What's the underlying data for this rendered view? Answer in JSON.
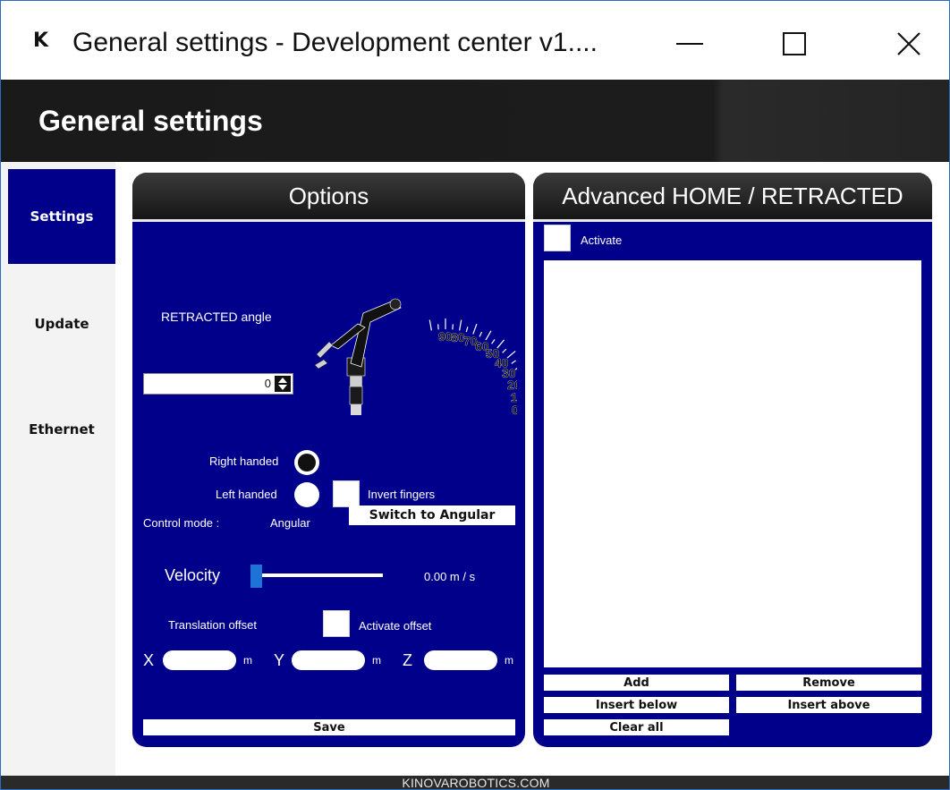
{
  "window": {
    "logo": "K",
    "title": "General settings - Development center v1...."
  },
  "header": {
    "title": "General settings"
  },
  "sidebar": {
    "items": [
      {
        "label": "Settings",
        "active": true
      },
      {
        "label": "Update",
        "active": false
      },
      {
        "label": "Ethernet",
        "active": false
      }
    ]
  },
  "options": {
    "title": "Options",
    "retracted_label": "RETRACTED angle",
    "retracted_value": "0",
    "gauge_ticks": [
      "90",
      "80",
      "70",
      "60",
      "50",
      "40",
      "30",
      "20",
      "10",
      "0"
    ],
    "right_handed_label": "Right handed",
    "right_handed_selected": true,
    "left_handed_label": "Left handed",
    "left_handed_selected": false,
    "invert_fingers_label": "Invert fingers",
    "invert_fingers_checked": false,
    "control_mode_label": "Control mode :",
    "control_mode_value": "Angular",
    "switch_button": "Switch to Angular",
    "velocity_label": "Velocity",
    "velocity_value": "0.00 m / s",
    "velocity_fraction": 0,
    "translation_offset_label": "Translation offset",
    "activate_offset_label": "Activate offset",
    "activate_offset_checked": false,
    "x_label": "X",
    "y_label": "Y",
    "z_label": "Z",
    "unit": "m",
    "save_button": "Save"
  },
  "advanced": {
    "title": "Advanced HOME / RETRACTED",
    "activate_label": "Activate",
    "activate_checked": false,
    "add_button": "Add",
    "remove_button": "Remove",
    "insert_below_button": "Insert below",
    "insert_above_button": "Insert above",
    "clear_all_button": "Clear all"
  },
  "footer": {
    "text": "KINOVAROBOTICS.COM"
  },
  "colors": {
    "panel_blue": "#00008b",
    "header_dark": "#1a1a1a",
    "slider_blue": "#1e74d6"
  }
}
